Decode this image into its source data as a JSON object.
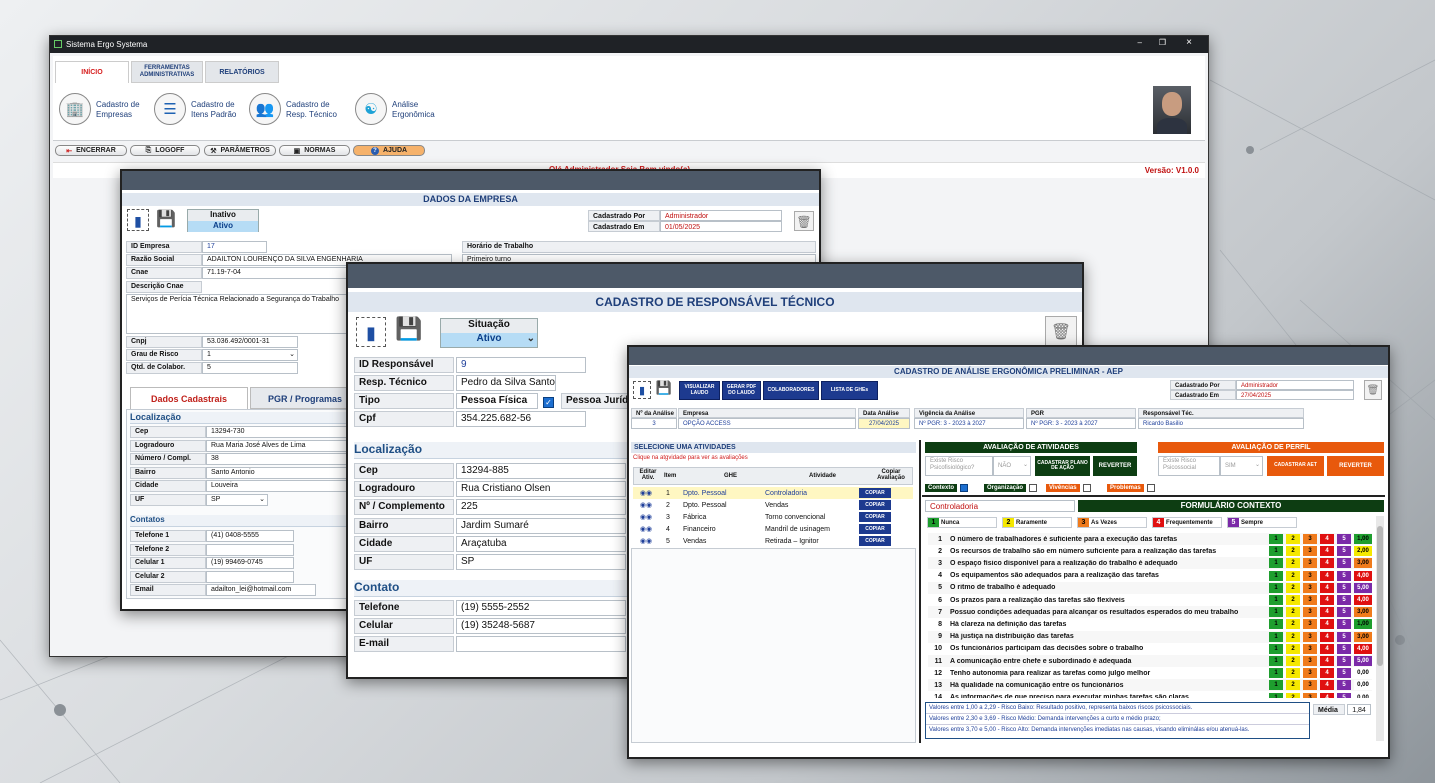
{
  "main": {
    "title": "Sistema Ergo Systema",
    "tabs": [
      "INÍCIO",
      "FERRAMENTAS ADMINISTRATIVAS",
      "RELATÓRIOS"
    ],
    "ribbon": [
      {
        "l1": "Cadastro de",
        "l2": "Empresas"
      },
      {
        "l1": "Cadastro de",
        "l2": "Itens Padrão"
      },
      {
        "l1": "Cadastro de",
        "l2": "Resp. Técnico"
      },
      {
        "l1": "Análise",
        "l2": "Ergonômica"
      }
    ],
    "toolbar": [
      "ENCERRAR",
      "LOGOFF",
      "PARÂMETROS",
      "NORMAS",
      "AJUDA"
    ],
    "greeting": "Olá Administrador Seja Bem vindo(a)",
    "version": "Versão: V1.0.0"
  },
  "empresa": {
    "title": "DADOS DA EMPRESA",
    "status_label": "Inativo",
    "status_value": "Ativo",
    "cad_por_label": "Cadastrado Por",
    "cad_por": "Administrador",
    "cad_em_label": "Cadastrado Em",
    "cad_em": "01/05/2025",
    "fields": {
      "id_l": "ID Empresa",
      "id": "17",
      "rs_l": "Razão Social",
      "rs": "ADAILTON LOURENÇO DA SILVA ENGENHARIA",
      "cnae_l": "Cnae",
      "cnae": "71.19-7-04",
      "desc_l": "Descrição Cnae",
      "desc": "Serviços de Perícia Técnica Relacionado a Segurança do Trabalho",
      "horario_l": "Horário de Trabalho",
      "horario": "Primeiro turno",
      "cnpj_l": "Cnpj",
      "cnpj": "53.036.492/0001-31",
      "grau_l": "Grau de Risco",
      "grau": "1",
      "qtd_l": "Qtd. de Colabor.",
      "qtd": "5"
    },
    "tabs": [
      "Dados Cadastrais",
      "PGR / Programas"
    ],
    "loc": "Localização",
    "loc_fields": [
      [
        "Cep",
        "13294-730"
      ],
      [
        "Logradouro",
        "Rua Maria José Alves de Lima"
      ],
      [
        "Número / Compl.",
        "38"
      ],
      [
        "Bairro",
        "Santo Antonio"
      ],
      [
        "Cidade",
        "Louveira"
      ],
      [
        "UF",
        "SP"
      ]
    ],
    "contatos": "Contatos",
    "cont_fields": [
      [
        "Telefone 1",
        "(41) 0408-5555"
      ],
      [
        "Telefone 2",
        ""
      ],
      [
        "Celular 1",
        "(19) 99469-0745"
      ],
      [
        "Celular 2",
        ""
      ],
      [
        "Email",
        "adailton_lei@hotmail.com"
      ]
    ]
  },
  "resp": {
    "title": "CADASTRO DE RESPONSÁVEL TÉCNICO",
    "sit_label": "Situação",
    "sit_value": "Ativo",
    "fields": [
      [
        "ID Responsável",
        "9"
      ],
      [
        "Resp. Técnico",
        "Pedro da Silva Santos"
      ],
      [
        "Tipo",
        "Pessoa Física"
      ],
      [
        "Cpf",
        "354.225.682-56"
      ]
    ],
    "tipo2": "Pessoa Jurídica",
    "loc": "Localização",
    "loc_fields": [
      [
        "Cep",
        "13294-885"
      ],
      [
        "Logradouro",
        "Rua Cristiano Olsen"
      ],
      [
        "Nº / Complemento",
        "225"
      ],
      [
        "Bairro",
        "Jardim Sumaré"
      ],
      [
        "Cidade",
        "Araçatuba"
      ],
      [
        "UF",
        "SP"
      ]
    ],
    "contato": "Contato",
    "cont_fields": [
      [
        "Telefone",
        "(19) 5555-2552"
      ],
      [
        "Celular",
        "(19) 35248-5687"
      ],
      [
        "E-mail",
        ""
      ]
    ]
  },
  "aep": {
    "title": "CADASTRO DE ANÁLISE ERGONÔMICA PRELIMINAR - AEP",
    "buttons": [
      "VISUALIZAR LAUDO",
      "GERAR PDF DO LAUDO",
      "COLABORADORES",
      "LISTA DE GHEs"
    ],
    "cad_por_label": "Cadastrado Por",
    "cad_por": "Administrador",
    "cad_em_label": "Cadastrado Em",
    "cad_em": "27/04/2025",
    "header": [
      "Nº da Análise",
      "Empresa",
      "Data Análise",
      "Vigência da Análise",
      "PGR",
      "Responsável Téc."
    ],
    "row": [
      "3",
      "OPÇÃO ACCESS",
      "27/04/2025",
      "Nº PGR: 3 - 2023 à 2027",
      "Nº PGR: 3 - 2023 à 2027",
      "Ricardo Basilio"
    ],
    "sel_title": "SELECIONE UMA ATIVIDADES",
    "sel_hint": "Clique na atgvidade para ver as avaliações",
    "act_cols": [
      "Editar Ativ.",
      "Item",
      "GHE",
      "Atividade",
      "Copiar Avaliação"
    ],
    "acts": [
      [
        "1",
        "Dpto. Pessoal",
        "Controladoria"
      ],
      [
        "2",
        "Dpto. Pessoal",
        "Vendas"
      ],
      [
        "3",
        "Fábrica",
        "Torno convencional"
      ],
      [
        "4",
        "Financeiro",
        "Mandril de usinagem"
      ],
      [
        "5",
        "Vendas",
        "Retirada – Ignitor"
      ]
    ],
    "copy": "COPIAR",
    "aval_title": "AVALIAÇÃO DE ATIVIDADES",
    "perfil_title": "AVALIAÇÃO DE PERFIL",
    "risco_psico": "Existe Risco Psicofisiológico?",
    "risco_psico_v": "NÃO",
    "cad_plano": "CADASTRAR PLANO DE AÇÃO",
    "reverter": "REVERTER",
    "risco_soc": "Existe Risco Psicossocial",
    "risco_soc_v": "SIM",
    "cad_aet": "CADASTRAR AET",
    "checks": [
      "Contexto",
      "Organização",
      "Vivências",
      "Problemas"
    ],
    "current": "Controladoria",
    "form_title": "FORMULÁRIO CONTEXTO",
    "legend": [
      [
        "1",
        "Nunca"
      ],
      [
        "2",
        "Raramente"
      ],
      [
        "3",
        "As Vezes"
      ],
      [
        "4",
        "Frequentemente"
      ],
      [
        "5",
        "Sempre"
      ]
    ],
    "questions": [
      [
        "1",
        "O número de trabalhadores é suficiente para a execução das tarefas",
        "1,00"
      ],
      [
        "2",
        "Os recursos de trabalho são em número suficiente para a realização das tarefas",
        "2,00"
      ],
      [
        "3",
        "O espaço físico disponível para a realização do trabalho é adequado",
        "3,00"
      ],
      [
        "4",
        "Os equipamentos são adequados para a realização das tarefas",
        "4,00"
      ],
      [
        "5",
        "O ritmo de trabalho é adequado",
        "5,00"
      ],
      [
        "6",
        "Os prazos para a realização das tarefas são flexíveis",
        "4,00"
      ],
      [
        "7",
        "Possuo condições adequadas para alcançar os resultados esperados do meu trabalho",
        "3,00"
      ],
      [
        "8",
        "Há clareza na definição das tarefas",
        "1,00"
      ],
      [
        "9",
        "Há justiça na distribuição das tarefas",
        "3,00"
      ],
      [
        "10",
        "Os funcionários participam das decisões sobre o trabalho",
        "4,00"
      ],
      [
        "11",
        "A comunicação entre chefe e subordinado é adequada",
        "5,00"
      ],
      [
        "12",
        "Tenho autonomia para realizar as tarefas como julgo melhor",
        "0,00"
      ],
      [
        "13",
        "Há qualidade na comunicação entre os funcionários",
        "0,00"
      ],
      [
        "14",
        "As informações de que preciso para executar minhas tarefas são claras",
        "0,00"
      ]
    ],
    "notes": [
      "Valores entre 1,00 a 2,29  - Risco Baixo: Resultado positivo, representa baixos riscos psicossociais.",
      "Valores entre 2,30 e 3,69 - Risco Médio: Demanda intervenções a curto e médio prazo;",
      "Valores entre 3,70 e 5,00 - Risco Alto: Demanda intervenções imediatas nas causas, visando eliminálas e/ou atenuá-las."
    ],
    "media_label": "Média",
    "media": "1,84"
  }
}
